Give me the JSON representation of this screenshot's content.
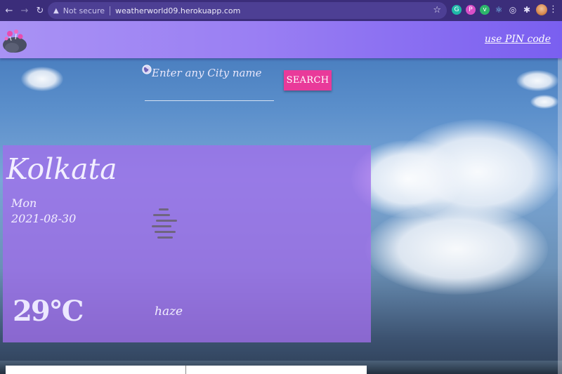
{
  "browser": {
    "security_label": "Not secure",
    "url": "weatherworld09.herokuapp.com",
    "extensions": [
      "G",
      "P",
      "v",
      "react",
      "o",
      "puzzle"
    ]
  },
  "navbar": {
    "pin_link": "use PIN code"
  },
  "search": {
    "placeholder": "Enter any City name",
    "button_label": "SEARCH"
  },
  "weather": {
    "city": "Kolkata",
    "day": "Mon",
    "date": "2021-08-30",
    "temperature": "29°C",
    "condition": "haze",
    "icon": "haze-icon"
  },
  "colors": {
    "navbar_start": "#a992f4",
    "navbar_end": "#7a5ff0",
    "search_button": "#e93a9a",
    "card": "rgba(160,110,235,0.78)"
  }
}
